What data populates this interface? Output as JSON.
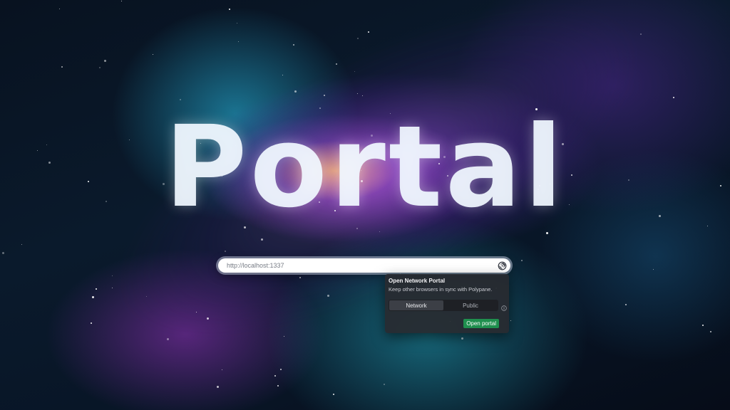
{
  "hero": {
    "title": "Portal"
  },
  "url_bar": {
    "value": "http://localhost:1337",
    "icon": "portal-swirl-icon"
  },
  "popover": {
    "title": "Open Network Portal",
    "description": "Keep other browsers in sync with Polypane.",
    "modes": [
      "Network",
      "Public"
    ],
    "selected_mode": "Network",
    "info_icon": "info-icon",
    "action_label": "Open portal",
    "action_color": "#1f8f4e"
  },
  "colors": {
    "popover_bg": "#2a2c31",
    "title_text": "#f0f8ff"
  }
}
